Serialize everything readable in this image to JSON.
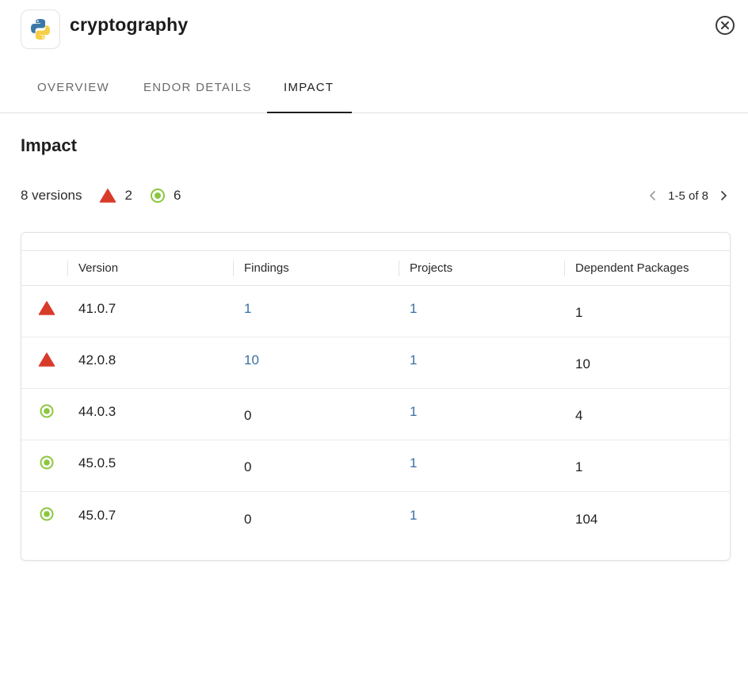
{
  "package": {
    "name": "cryptography",
    "icon": "python-logo-icon"
  },
  "tabs": [
    {
      "label": "OVERVIEW",
      "active": false
    },
    {
      "label": "ENDOR DETAILS",
      "active": false
    },
    {
      "label": "IMPACT",
      "active": true
    }
  ],
  "section_title": "Impact",
  "summary": {
    "versions_label": "8 versions",
    "warning_count": "2",
    "ok_count": "6"
  },
  "pagination": {
    "label": "1-5 of 8"
  },
  "colors": {
    "warning": "#d93b2b",
    "ok": "#8cc63f",
    "link": "#3a6fa3"
  },
  "table": {
    "columns": [
      "Version",
      "Findings",
      "Projects",
      "Dependent Packages"
    ],
    "rows": [
      {
        "status": "warning",
        "version": "41.0.7",
        "findings": "1",
        "projects": "1",
        "dependents": "1"
      },
      {
        "status": "warning",
        "version": "42.0.8",
        "findings": "10",
        "projects": "1",
        "dependents": "10"
      },
      {
        "status": "ok",
        "version": "44.0.3",
        "findings": "0",
        "projects": "1",
        "dependents": "4"
      },
      {
        "status": "ok",
        "version": "45.0.5",
        "findings": "0",
        "projects": "1",
        "dependents": "1"
      },
      {
        "status": "ok",
        "version": "45.0.7",
        "findings": "0",
        "projects": "1",
        "dependents": "104"
      }
    ]
  }
}
